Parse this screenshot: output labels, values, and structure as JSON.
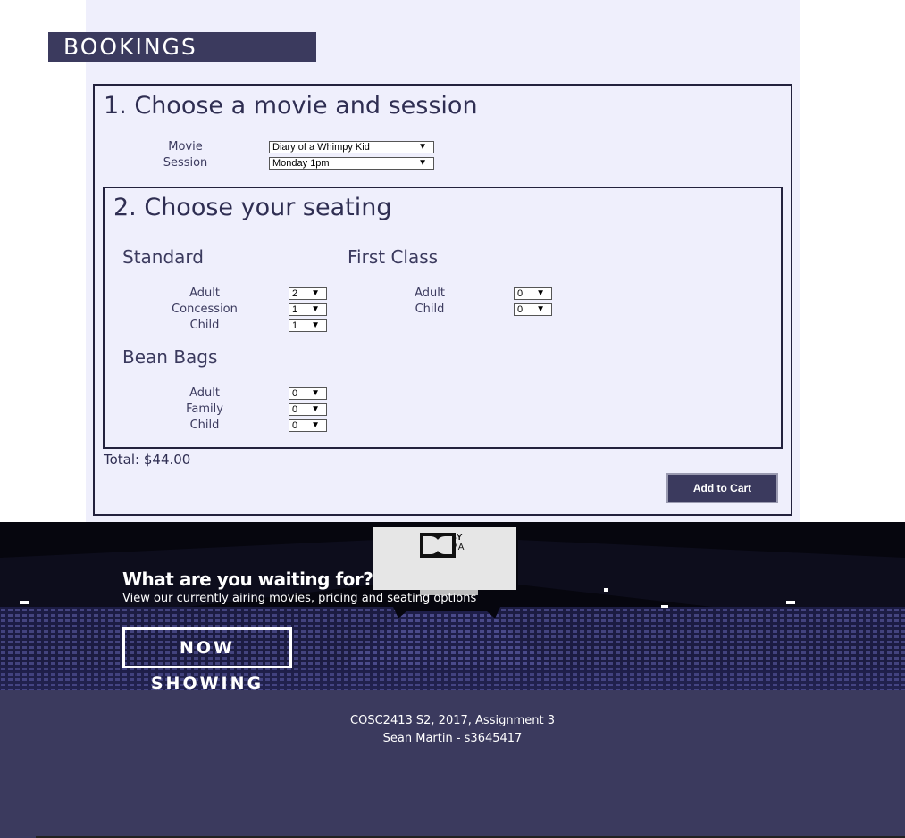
{
  "header": {
    "title": "BOOKINGS"
  },
  "step1": {
    "title": "1. Choose a movie and session",
    "movie_label": "Movie",
    "movie_value": "Diary of a Whimpy Kid",
    "session_label": "Session",
    "session_value": "Monday 1pm"
  },
  "step2": {
    "title": "2. Choose your seating",
    "standard": {
      "title": "Standard",
      "rows": [
        {
          "label": "Adult",
          "value": "2"
        },
        {
          "label": "Concession",
          "value": "1"
        },
        {
          "label": "Child",
          "value": "1"
        }
      ]
    },
    "first_class": {
      "title": "First Class",
      "rows": [
        {
          "label": "Adult",
          "value": "0"
        },
        {
          "label": "Child",
          "value": "0"
        }
      ]
    },
    "bean_bags": {
      "title": "Bean Bags",
      "rows": [
        {
          "label": "Adult",
          "value": "0"
        },
        {
          "label": "Family",
          "value": "0"
        },
        {
          "label": "Child",
          "value": "0"
        }
      ]
    }
  },
  "total": "Total: $44.00",
  "add_to_cart": "Add to Cart",
  "hero": {
    "title": "What are you waiting for?",
    "subtitle": "View our currently airing movies, pricing and seating options",
    "button": "NOW SHOWING",
    "screen_logo_line1": "DOLBY",
    "screen_logo_line2": "CINEMA"
  },
  "footer": {
    "line1": "COSC2413 S2, 2017, Assignment 3",
    "line2": "Sean Martin - s3645417"
  },
  "icons": {
    "dropdown": "dropdown-arrow-icon",
    "dolby": "dolby-logo-icon"
  },
  "colors": {
    "brand": "#3b3a5e",
    "content_bg": "#efeffc",
    "border": "#23223d"
  }
}
